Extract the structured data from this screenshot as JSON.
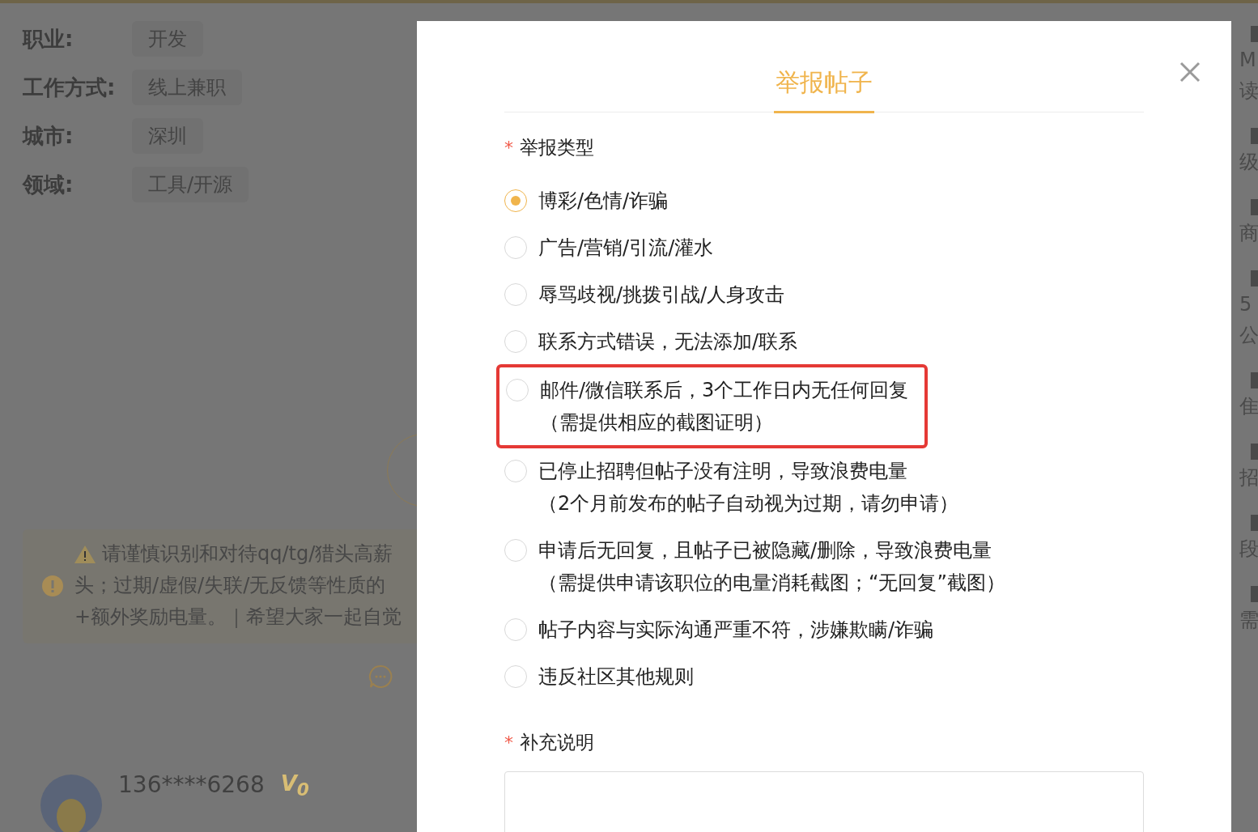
{
  "profile_fields": [
    {
      "label": "职业:",
      "value": "开发"
    },
    {
      "label": "工作方式:",
      "value": "线上兼职"
    },
    {
      "label": "城市:",
      "value": "深圳"
    },
    {
      "label": "领域:",
      "value": "工具/开源"
    }
  ],
  "notice": {
    "lines": [
      "请谨慎识别和对待qq/tg/猎头高薪",
      "头；过期/虚假/失联/无反馈等性质的",
      "+额外奖励电量。｜希望大家一起自觉"
    ]
  },
  "user": {
    "name": "136****6268",
    "badge": "V$_{0}$"
  },
  "side_sections": [
    {
      "lines": [
        "M",
        "读"
      ]
    },
    {
      "lines": [
        "级"
      ]
    },
    {
      "lines": [
        "商"
      ]
    },
    {
      "lines": [
        "5",
        "公"
      ]
    },
    {
      "lines": [
        "隹"
      ]
    },
    {
      "lines": [
        "招"
      ]
    },
    {
      "lines": [
        "段"
      ]
    },
    {
      "lines": [
        "需"
      ]
    }
  ],
  "modal": {
    "title": "举报帖子",
    "report_type": {
      "marker": "*",
      "label": "举报类型"
    },
    "options": [
      {
        "label": "博彩/色情/诈骗",
        "selected": true,
        "highlighted": false
      },
      {
        "label": "广告/营销/引流/灌水",
        "selected": false,
        "highlighted": false
      },
      {
        "label": "辱骂歧视/挑拨引战/人身攻击",
        "selected": false,
        "highlighted": false
      },
      {
        "label": "联系方式错误，无法添加/联系",
        "selected": false,
        "highlighted": false
      },
      {
        "label": "邮件/微信联系后，3个工作日内无任何回复",
        "note": "（需提供相应的截图证明）",
        "selected": false,
        "highlighted": true
      },
      {
        "label": "已停止招聘但帖子没有注明，导致浪费电量",
        "note": "（2个月前发布的帖子自动视为过期，请勿申请）",
        "selected": false,
        "highlighted": false
      },
      {
        "label": "申请后无回复，且帖子已被隐藏/删除，导致浪费电量",
        "note": "（需提供申请该职位的电量消耗截图；“无回复”截图）",
        "selected": false,
        "highlighted": false
      },
      {
        "label": "帖子内容与实际沟通严重不符，涉嫌欺瞒/诈骗",
        "selected": false,
        "highlighted": false
      },
      {
        "label": "违反社区其他规则",
        "selected": false,
        "highlighted": false
      }
    ],
    "supplement": {
      "marker": "*",
      "label": "补充说明"
    }
  }
}
